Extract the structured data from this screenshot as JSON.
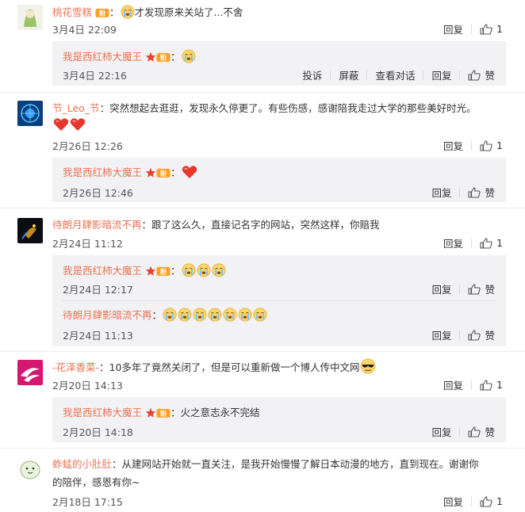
{
  "action_labels": {
    "reply": "回复",
    "report": "投诉",
    "block": "屏蔽",
    "view_thread": "查看对话",
    "like": "赞"
  },
  "comments": [
    {
      "user": "桃花雪糕",
      "text": "才发现原来关站了...不舍",
      "time": "3月4日 22:09",
      "likes": "1",
      "replies": [
        {
          "user": "我是西红柿大魔王",
          "text": "",
          "time": "3月4日 22:16",
          "like_label": "赞"
        }
      ]
    },
    {
      "user": "节_Leo_节",
      "text": "：突然想起去逛逛，发现永久停更了。有些伤感，感谢陪我走过大学的那些美好时光。",
      "time": "2月26日 12:26",
      "likes": "1",
      "replies": [
        {
          "user": "我是西红柿大魔王",
          "text": "",
          "time": "2月26日 12:46",
          "like_label": "赞"
        }
      ]
    },
    {
      "user": "待朗月肆影暗流不再",
      "text": "：跟了这么久，直接记名字的网站，突然这样，你赔我",
      "time": "2月24日 11:12",
      "likes": "1",
      "replies": [
        {
          "user": "我是西红柿大魔王",
          "text": "",
          "time": "2月24日 12:17",
          "like_label": "赞"
        },
        {
          "user": "待朗月肆影暗流不再",
          "text": "",
          "time": "2月24日 11:13",
          "like_label": "赞"
        }
      ]
    },
    {
      "user": "-花泽香菜-",
      "text": "：10多年了竟然关闭了，但是可以重新做一个博人传中文网",
      "time": "2月20日 14:13",
      "likes": "1",
      "replies": [
        {
          "user": "我是西红柿大魔王",
          "text": "：火之意志永不完结",
          "time": "2月20日 14:18",
          "like_label": "赞"
        }
      ]
    },
    {
      "user": "蚱蜢的小肚肚",
      "text": "：从建网站开始就一直关注，是我开始慢慢了解日本动漫的地方，直到现在。谢谢你",
      "text2": "的陪伴，感恩有你~",
      "time": "2月18日 17:15",
      "likes": "1"
    }
  ],
  "colors": {
    "name": "#eb7350",
    "reply_bg": "#f2f2f5",
    "text": "#333333"
  }
}
